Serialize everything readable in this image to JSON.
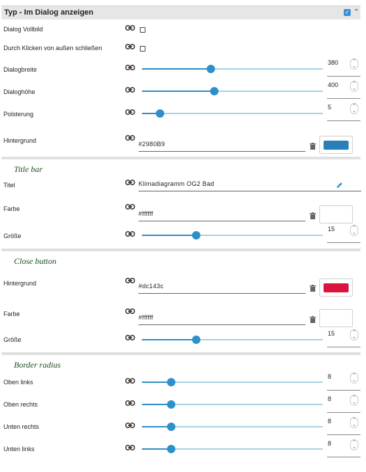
{
  "header": {
    "title": "Typ - Im Dialog anzeigen"
  },
  "rows": {
    "vollbild": {
      "label": "Dialog Vollbild"
    },
    "schliessen": {
      "label": "Durch Klicken von außen schließen"
    },
    "breite": {
      "label": "Dialogbreite",
      "value": "380",
      "level": 0.38
    },
    "hoehe": {
      "label": "Dialoghöhe",
      "value": "400",
      "level": 0.4
    },
    "polsterung": {
      "label": "Polsterung",
      "value": "5",
      "level": 0.1
    },
    "hintergrund": {
      "label": "Hintergrund",
      "value": "#2980B9",
      "color": "#2980b9"
    }
  },
  "titlebar": {
    "title": "Title bar",
    "titel": {
      "label": "Titel",
      "value": "Klimadiagramm OG2 Bad"
    },
    "farbe": {
      "label": "Farbe",
      "value": "#ffffff",
      "color": "#ffffff"
    },
    "groesse": {
      "label": "Größe",
      "value": "15",
      "level": 0.3
    }
  },
  "closebutton": {
    "title": "Close button",
    "hintergrund": {
      "label": "Hintergrund",
      "value": "#dc143c",
      "color": "#dc143c"
    },
    "farbe": {
      "label": "Farbe",
      "value": "#ffffff",
      "color": "#ffffff"
    },
    "groesse": {
      "label": "Größe",
      "value": "15",
      "level": 0.3
    }
  },
  "borderradius": {
    "title": "Border radius",
    "oben_links": {
      "label": "Oben links",
      "value": "8",
      "level": 0.16
    },
    "oben_rechts": {
      "label": "Oben rechts",
      "value": "8",
      "level": 0.16
    },
    "unten_rechts": {
      "label": "Unten rechts",
      "value": "8",
      "level": 0.16
    },
    "unten_links": {
      "label": "Unten links",
      "value": "8",
      "level": 0.16
    }
  }
}
